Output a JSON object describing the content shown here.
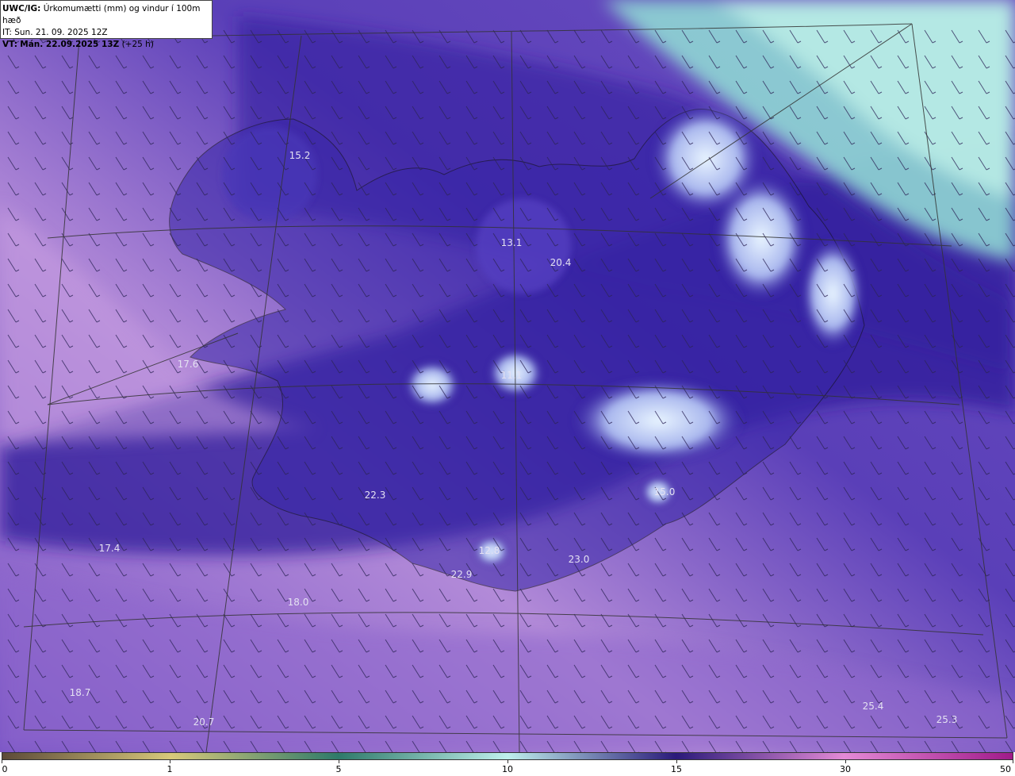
{
  "info": {
    "model": "UWC/IG:",
    "title_rest": "Úrkomumætti (mm) og vindur í 100m hæð",
    "it": "IT: Sun. 21. 09. 2025 12Z",
    "vt_label": "VT:",
    "vt_value": "Mán. 22.09.2025 13Z",
    "vt_offset": "(+25 h)"
  },
  "map_labels": [
    "15.2",
    "13.1",
    "20.4",
    "17.6",
    "11.1",
    "22.3",
    "15.0",
    "12.8",
    "22.9",
    "23.0",
    "17.4",
    "18.0",
    "18.7",
    "20.7",
    "25.4",
    "25.3"
  ],
  "colorbar": {
    "ticks": [
      "0",
      "1",
      "5",
      "10",
      "15",
      "30",
      "50"
    ],
    "colors": {
      "c0": "#5c4a38",
      "c1": "#d8c97a",
      "c5": "#2e7a6a",
      "c10": "#bff0ec",
      "c15": "#2a1a7a",
      "c30": "#e48ad6",
      "c50": "#a01a8a"
    }
  }
}
